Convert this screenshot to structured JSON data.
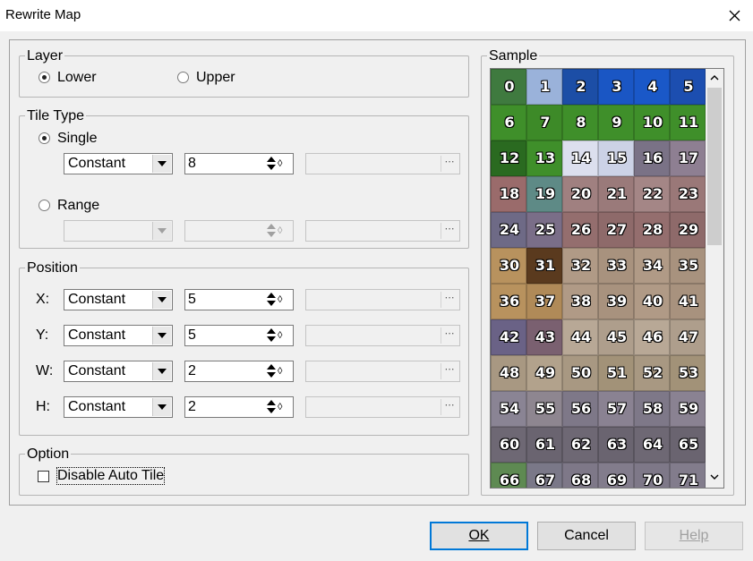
{
  "window": {
    "title": "Rewrite Map",
    "close_icon": "close-icon"
  },
  "layer": {
    "label": "Layer",
    "options": [
      "Lower",
      "Upper"
    ],
    "selected": "Lower"
  },
  "tile_type": {
    "label": "Tile Type",
    "single": {
      "label": "Single",
      "selected": true,
      "mode": "Constant",
      "value": "8"
    },
    "range": {
      "label": "Range",
      "selected": false,
      "mode": "",
      "value": ""
    }
  },
  "position": {
    "label": "Position",
    "rows": [
      {
        "label": "X:",
        "mode": "Constant",
        "value": "5"
      },
      {
        "label": "Y:",
        "mode": "Constant",
        "value": "5"
      },
      {
        "label": "W:",
        "mode": "Constant",
        "value": "2"
      },
      {
        "label": "H:",
        "mode": "Constant",
        "value": "2"
      }
    ]
  },
  "option": {
    "label": "Option",
    "disable_auto_tile": {
      "label": "Disable Auto Tile",
      "checked": false
    }
  },
  "sample": {
    "label": "Sample",
    "tiles": [
      "0",
      "1",
      "2",
      "3",
      "4",
      "5",
      "6",
      "7",
      "8",
      "9",
      "10",
      "11",
      "12",
      "13",
      "14",
      "15",
      "16",
      "17",
      "18",
      "19",
      "20",
      "21",
      "22",
      "23",
      "24",
      "25",
      "26",
      "27",
      "28",
      "29",
      "30",
      "31",
      "32",
      "33",
      "34",
      "35",
      "36",
      "37",
      "38",
      "39",
      "40",
      "41",
      "42",
      "43",
      "44",
      "45",
      "46",
      "47",
      "48",
      "49",
      "50",
      "51",
      "52",
      "53",
      "54",
      "55",
      "56",
      "57",
      "58",
      "59",
      "60",
      "61",
      "62",
      "63",
      "64",
      "65",
      "66",
      "67",
      "68",
      "69",
      "70",
      "71"
    ],
    "tile_colors": [
      "#3f7a3f",
      "#9ab2da",
      "#1c4ea6",
      "#1a56c4",
      "#1a58c8",
      "#1c4eb0",
      "#3f8f2a",
      "#3d8a28",
      "#3f8f2a",
      "#3f8f2a",
      "#3f8f2a",
      "#3f8f2a",
      "#2a6a20",
      "#3f8f2a",
      "#dcdfee",
      "#ccd2e6",
      "#7a7286",
      "#8e7f92",
      "#9a6b6b",
      "#5e8a86",
      "#a08080",
      "#9a7a7a",
      "#a48686",
      "#9a7878",
      "#6e6a86",
      "#7a6e88",
      "#946e6e",
      "#8e6a6a",
      "#946e6e",
      "#8e6a6a",
      "#b8925e",
      "#5a3a1e",
      "#b09a86",
      "#a8927e",
      "#b09a86",
      "#a8927e",
      "#b8925e",
      "#b08a58",
      "#b09a86",
      "#a8927e",
      "#b09a86",
      "#a8927e",
      "#6a6286",
      "#7a6070",
      "#b8a896",
      "#ae9e8c",
      "#b8a896",
      "#ae9e8c",
      "#a89882",
      "#b2a28c",
      "#a89882",
      "#a29278",
      "#a89882",
      "#a29278",
      "#8a8494",
      "#8e8690",
      "#7e7888",
      "#8a8292",
      "#7e7888",
      "#8a8292",
      "#6e6874",
      "#6a6470",
      "#6e6874",
      "#6a6470",
      "#6e6874",
      "#6a6470",
      "#5e8a52",
      "#7a7888",
      "#7e7888",
      "#827c8c",
      "#7e7888",
      "#827c8c"
    ]
  },
  "buttons": {
    "ok": "OK",
    "cancel": "Cancel",
    "help": "Help"
  }
}
